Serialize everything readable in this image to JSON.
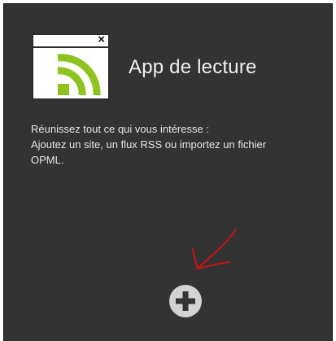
{
  "app_tile": {
    "close_glyph": "×",
    "icon": "rss-feed-icon",
    "accent_color": "#8dc21f"
  },
  "title": "App de lecture",
  "description": {
    "line1": "Réunissez tout ce qui vous intéresse :",
    "line2": "Ajoutez un site, un flux RSS ou importez un fichier",
    "line3": "OPML."
  },
  "add_button": {
    "icon": "plus-icon"
  },
  "annotation": {
    "color": "#cc1111",
    "icon": "red-arrow-annotation"
  }
}
